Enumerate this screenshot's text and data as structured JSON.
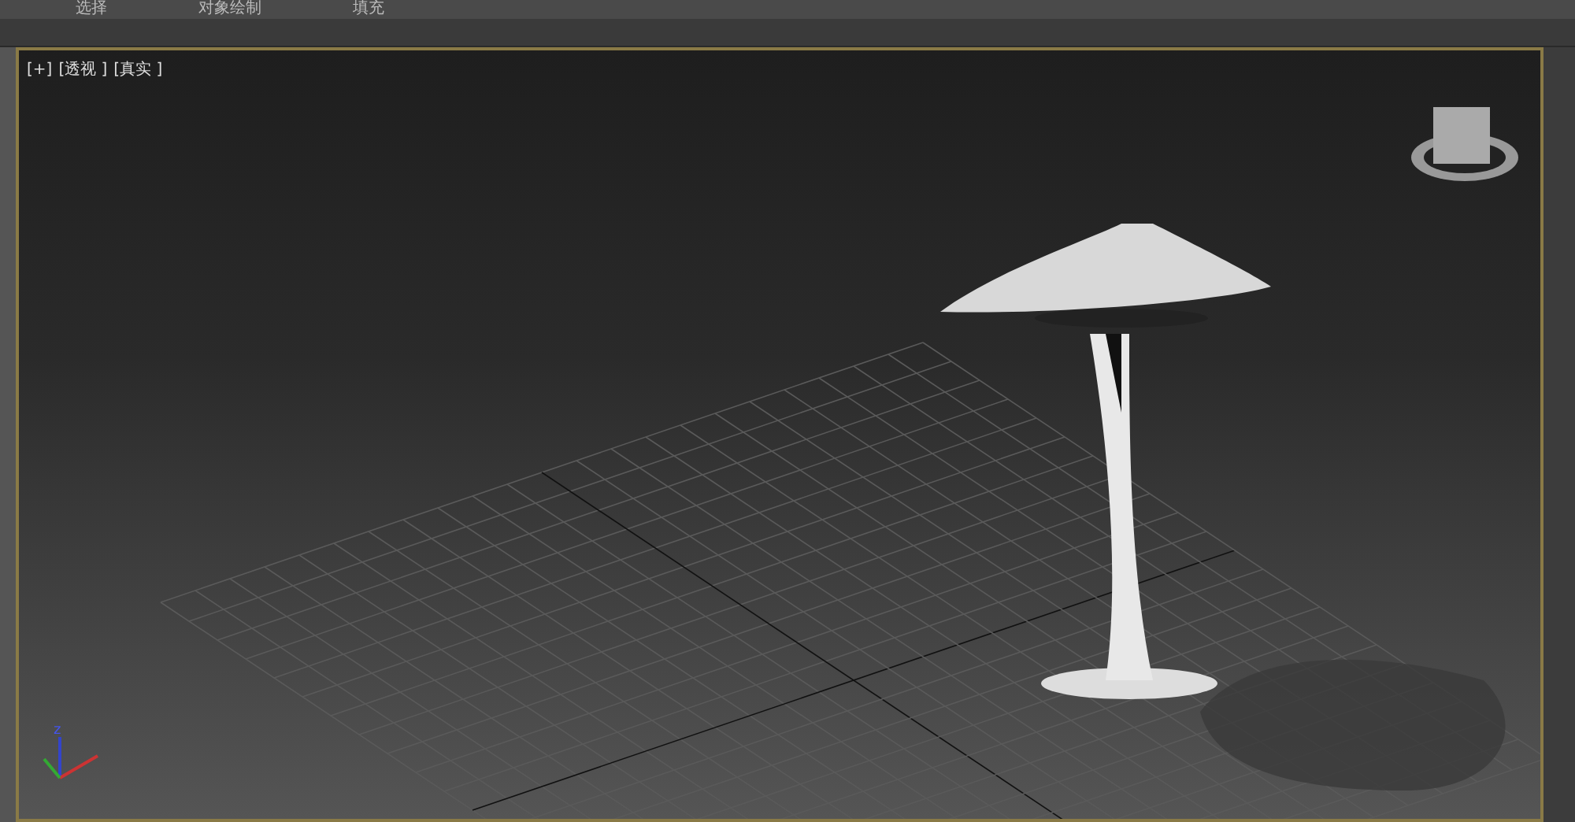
{
  "menu": [
    {
      "label": "选择"
    },
    {
      "label": "对象绘制"
    },
    {
      "label": "填充"
    }
  ],
  "viewport": {
    "labels": [
      "[+]",
      "[透视 ]",
      "[真实 ]"
    ],
    "axis_label": "z"
  }
}
